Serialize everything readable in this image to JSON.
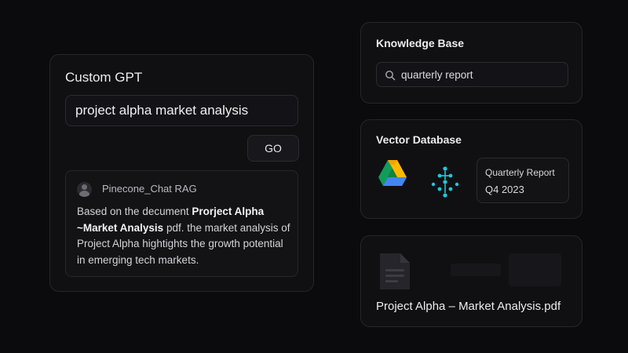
{
  "custom_gpt": {
    "title": "Custom GPT",
    "prompt_value": "project alpha market analysis",
    "go_label": "GO",
    "answer": {
      "source": "Pinecone_Chat RAG",
      "text_1": "Based on the decument ",
      "bold_1": "Prorject Alpha",
      "bold_2": "~Market Analysis",
      "text_2": " pdf. the market analysis of Project Alpha hightights the growth potential in emerging tech markets."
    }
  },
  "knowledge_base": {
    "title": "Knowledge Base",
    "search_value": "quarterly report",
    "icons": {
      "search": "search-icon"
    }
  },
  "vector_database": {
    "title": "Vector Database",
    "icons": {
      "source_a": "google-drive-icon",
      "source_b": "pinecone-icon"
    },
    "report": {
      "name": "Quarterly Report",
      "period": "Q4 2023"
    }
  },
  "document": {
    "filename": "Project Alpha – Market Analysis.pdf",
    "icons": {
      "file": "document-icon"
    }
  },
  "colors": {
    "background": "#0b0b0d",
    "card": "#101013",
    "border": "#26262b",
    "pinecone_teal": "#1fc8d9"
  }
}
